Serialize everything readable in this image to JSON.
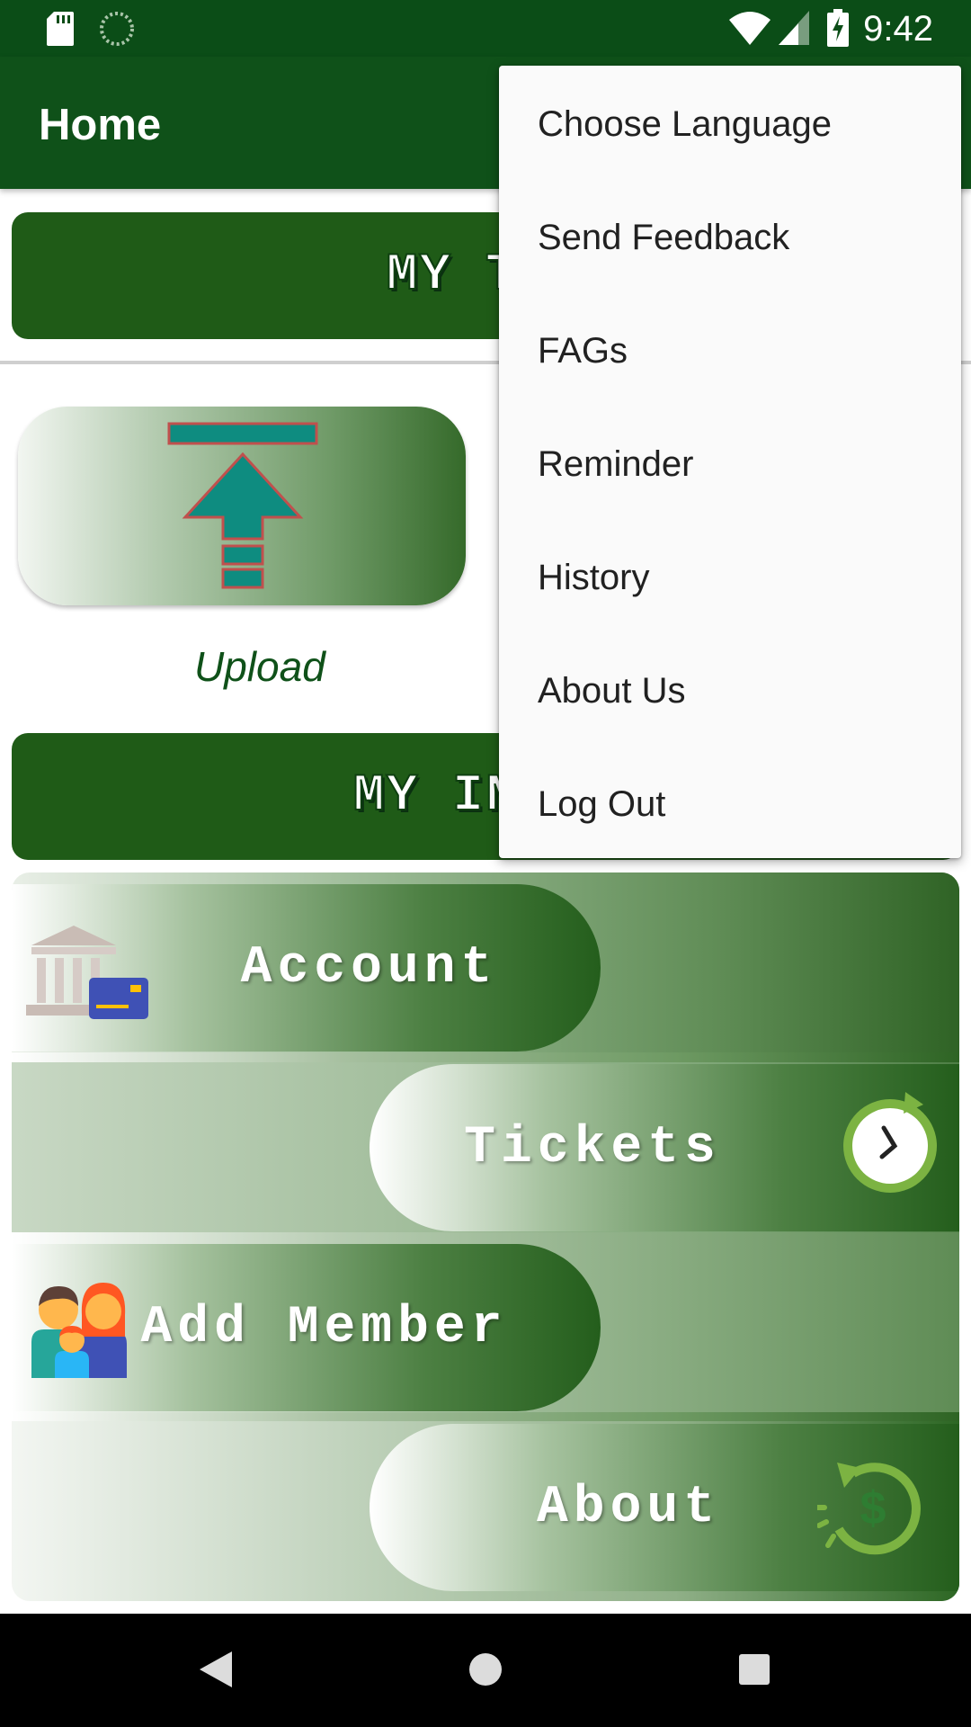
{
  "status_bar": {
    "time": "9:42"
  },
  "app_bar": {
    "title": "Home"
  },
  "tickets_banner": {
    "label": "MY TIC"
  },
  "upload": {
    "label": "Upload"
  },
  "info_banner": {
    "label": "MY INFOR"
  },
  "info_items": [
    {
      "label": "Account",
      "icon": "bank-card-icon"
    },
    {
      "label": "Tickets",
      "icon": "timer-icon"
    },
    {
      "label": "Add Member",
      "icon": "family-icon"
    },
    {
      "label": "About",
      "icon": "money-refresh-icon"
    }
  ],
  "overflow_menu": {
    "items": [
      {
        "label": "Choose Language"
      },
      {
        "label": "Send Feedback"
      },
      {
        "label": "FAGs"
      },
      {
        "label": "Reminder"
      },
      {
        "label": "History"
      },
      {
        "label": "About Us"
      },
      {
        "label": "Log Out"
      }
    ]
  },
  "colors": {
    "primary": "#0f5119",
    "status_bar": "#0b4d17",
    "accent_teal": "#0e8c80"
  }
}
